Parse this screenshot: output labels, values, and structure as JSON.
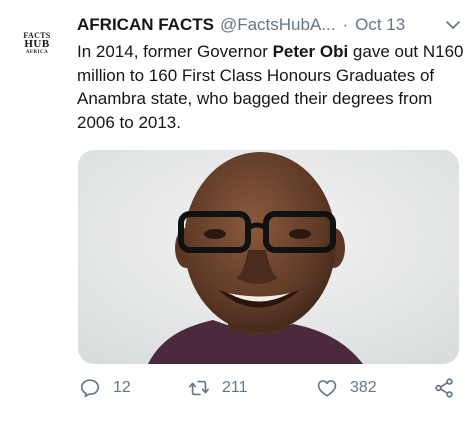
{
  "account": {
    "name": "AFRICAN FACTS",
    "handle": "@FactsHubA...",
    "separator": "·",
    "date": "Oct 13",
    "avatar_lines": [
      "FACTS",
      "HUB",
      "AFRICA"
    ]
  },
  "tweet": {
    "text_before": "In 2014, former Governor ",
    "text_bold": "Peter Obi",
    "text_after": " gave out N160 million to 160 First Class Honours Graduates of Anambra state, who bagged their degrees from 2006 to 2013."
  },
  "media": {
    "icon": "photo-of-smiling-man"
  },
  "actions": {
    "reply_count": "12",
    "retweet_count": "211",
    "like_count": "382"
  },
  "colors": {
    "text": "#14171a",
    "muted": "#657786",
    "background": "#ffffff"
  }
}
